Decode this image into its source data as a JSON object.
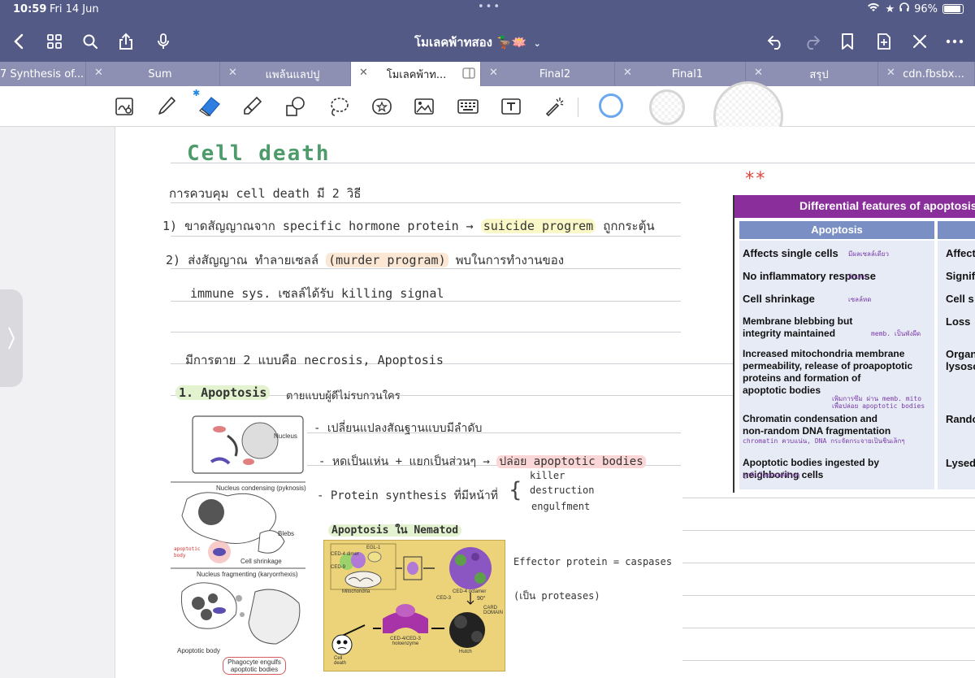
{
  "status": {
    "time": "10:59",
    "date": "Fri 14 Jun",
    "battery": "96%",
    "battery_level": 0.96
  },
  "nav": {
    "title": "โมเลคพ้าทสอง 🦆🪷"
  },
  "tabs": [
    {
      "label": "7 Synthesis of..."
    },
    {
      "label": "Sum"
    },
    {
      "label": "แพล้นแลปปู"
    },
    {
      "label": "โมเลคพ้าท..."
    },
    {
      "label": "Final2"
    },
    {
      "label": "Final1"
    },
    {
      "label": "สรุป"
    },
    {
      "label": "cdn.fbsbx..."
    }
  ],
  "note": {
    "title": "Cell death",
    "line1": "การควบคุม cell death มี 2 วิธี",
    "line2_a": "1) ขาดสัญญาณจาก specific hormone protein → ",
    "line2_b": "suicide progrem",
    "line2_c": " ถูกกระตุ้น",
    "line3_a": "2) ส่งสัญญาณ ทำลายเซลล์ ",
    "line3_b": "(murder program)",
    "line3_c": " พบในการทำงานของ",
    "line4": "immune sys. เซลล์ได้รับ killing signal",
    "line5": "มีการตาย 2 แบบคือ necrosis, Apoptosis",
    "apop_heading": "1. Apoptosis",
    "apop_desc": "ตายแบบผู้ดีไม่รบกวนใคร",
    "bullet1": "- เปลี่ยนแปลงสัณฐานแบบมีลำดับ",
    "bullet2_a": "- หดเป็นแห่น + แยกเป็นส่วนๆ → ",
    "bullet2_b": "ปล่อย apoptotic bodies",
    "bullet3": "- Protein synthesis ที่มีหน้าที่",
    "branch1": "killer",
    "branch2": "destruction",
    "branch3": "engulfment",
    "nemat_heading": "Apoptosis ใน Nematod",
    "effector": "Effector protein = caspases",
    "proteases": "(เป็น proteases)",
    "star": "**"
  },
  "cellfig": {
    "nucleus": "Nucleus",
    "condensing": "Nucleus condensing (pyknosis)",
    "blebs": "Blebs",
    "shrinkage": "Cell shrinkage",
    "apoptotic_note": "apoptotic body",
    "fragmenting": "Nucleus fragmenting (karyorrhexis)",
    "apoptotic_body": "Apoptotic body",
    "phagocyte": "Phagocyte engulfs apoptotic bodies"
  },
  "nematfig": {
    "egl1": "EGL-1",
    "ced4_dimer": "CED-4 dimer",
    "ced9": "CED-9",
    "mito": "Mitochondria",
    "ced4_octamer": "CED-4 octamer",
    "ced3": "CED-3",
    "card": "CARD DOMAIN",
    "angle": "90°",
    "hutch": "Hutch",
    "holo": "CED-4/CED-3 holoenzyme",
    "death": "Cell death"
  },
  "table": {
    "header": "Differential features of apoptosis",
    "col1": "Apoptosis",
    "col2": "",
    "rows": [
      {
        "feature": "Affects single cells",
        "note": "มีผลเซลล์เดียว",
        "right": "Affect"
      },
      {
        "feature": "No inflammatory response",
        "note": "อักเสบ",
        "right": "Signifi"
      },
      {
        "feature": "Cell shrinkage",
        "note": "เซลล์หด",
        "right": "Cell s"
      },
      {
        "feature": "Membrane blebbing but\nintegrity maintained",
        "note": "memb. เป็นพังผืด",
        "right": "Loss"
      },
      {
        "feature": "Increased mitochondria membrane\npermeability, release of proapoptotic\nproteins and formation of\napoptotic bodies",
        "note": "เพิ่มการซึม ผ่าน memb. mito เพื่อปล่อย apoptotic bodies",
        "right": "Organ\nlysoso"
      },
      {
        "feature": "Chromatin condensation and\nnon-random DNA fragmentation",
        "note": "chromatin ควบแน่น, DNA กระจัดกระจายเป็นชิ้นเล็กๆ",
        "right": "Rando"
      },
      {
        "feature": "Apoptotic bodies ingested by\nneighboring cells",
        "note": "ถูกกินโดยเซลล์ข้างๆ",
        "right": "Lysed"
      }
    ]
  },
  "colors": {
    "chrome": "#545a86",
    "tabbar": "#8d90b2",
    "accent_green": "#4d9b6a",
    "table_purple": "#8a2e9c",
    "table_blue": "#7a8fc4"
  }
}
